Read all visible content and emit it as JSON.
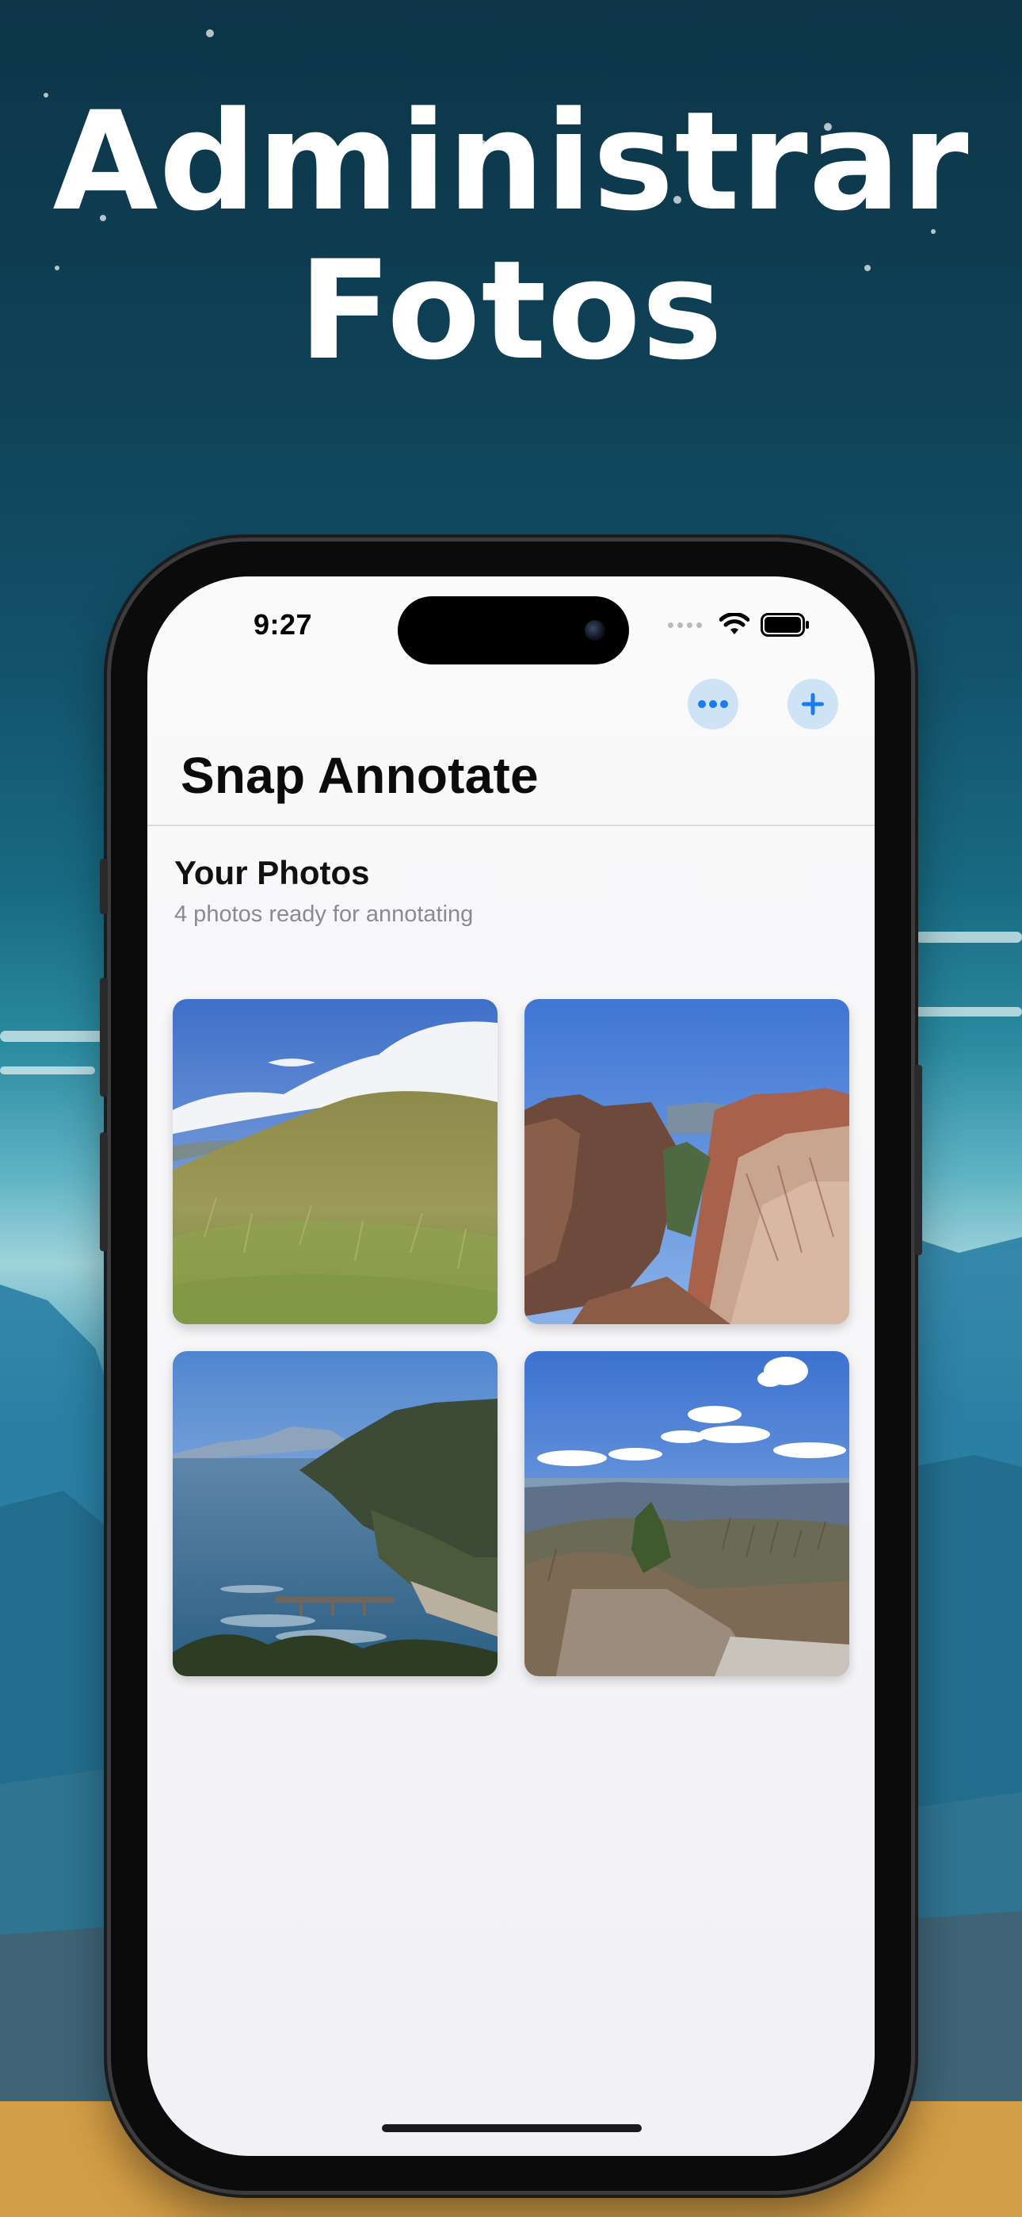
{
  "promo": {
    "headline_line1": "Administrar",
    "headline_line2": "Fotos"
  },
  "status_bar": {
    "time": "9:27",
    "icons": [
      "cellular-icon",
      "wifi-icon",
      "battery-icon"
    ]
  },
  "nav": {
    "title": "Snap Annotate",
    "more_button_icon": "ellipsis-icon",
    "add_button_icon": "plus-icon",
    "accent_color": "#1a7cf0",
    "button_bg_color": "#cfe3f7"
  },
  "section": {
    "title": "Your Photos",
    "subtitle": "4 photos ready for annotating"
  },
  "photos": [
    {
      "subject": "grassy-hill"
    },
    {
      "subject": "canyon"
    },
    {
      "subject": "coastal-bay"
    },
    {
      "subject": "mountain-overlook"
    }
  ]
}
